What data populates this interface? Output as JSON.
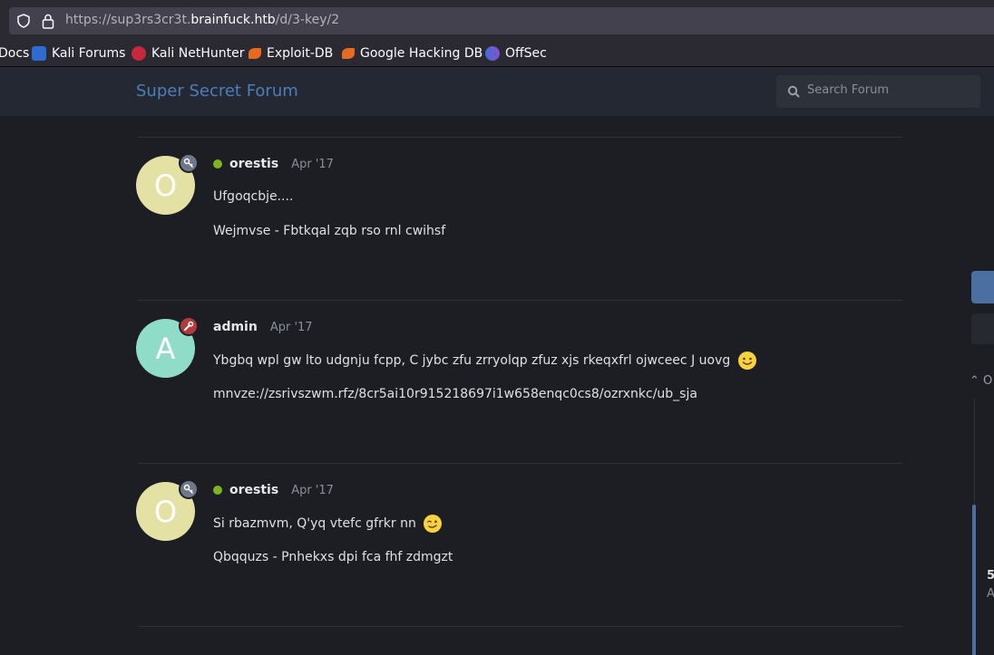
{
  "browser": {
    "url_prefix": "https://sup3rs3cr3t.",
    "url_host": "brainfuck.htb",
    "url_path": "/d/3-key/2",
    "bookmarks": [
      {
        "label": "Docs"
      },
      {
        "label": "Kali Forums"
      },
      {
        "label": "Kali NetHunter"
      },
      {
        "label": "Exploit-DB"
      },
      {
        "label": "Google Hacking DB"
      },
      {
        "label": "OffSec"
      }
    ]
  },
  "forum": {
    "title": "Super Secret Forum",
    "search_placeholder": "Search Forum"
  },
  "posts": [
    {
      "avatar_letter": "O",
      "avatar_color": "#e4e1a5",
      "badge": "key-icon",
      "author": "orestis",
      "online": true,
      "date": "Apr '17",
      "lines": [
        "Ufgoqcbje....",
        "Wejmvse - Fbtkqal zqb rso rnl cwihsf"
      ]
    },
    {
      "avatar_letter": "A",
      "avatar_color": "#8fdcc9",
      "badge": "wrench-icon",
      "author": "admin",
      "online": false,
      "date": "Apr '17",
      "lines": [
        "Ybgbq wpl gw lto udgnju fcpp, C jybc zfu zrryolqp zfuz xjs rkeqxfrl ojwceec J uovg",
        "mnvze://zsrivszwm.rfz/8cr5ai10r915218697i1w658enqc0cs8/ozrxnkc/ub_sja"
      ]
    },
    {
      "avatar_letter": "O",
      "avatar_color": "#e4e1a5",
      "badge": "key-icon",
      "author": "orestis",
      "online": true,
      "date": "Apr '17",
      "lines": [
        "Si rbazmvm, Q'yq vtefc gfrkr nn",
        "Qbqquzs - Pnhekxs dpi fca fhf zdmgzt"
      ]
    }
  ],
  "timeline": {
    "up_label": "O",
    "number": "5",
    "sub": "A"
  }
}
